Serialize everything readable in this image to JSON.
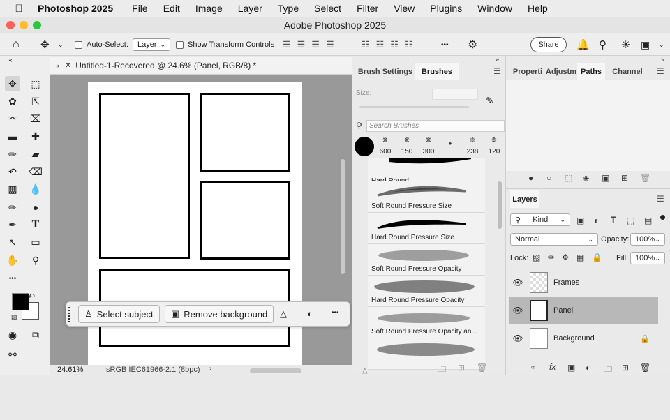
{
  "menubar": {
    "app_name": "Photoshop 2025",
    "items": [
      "File",
      "Edit",
      "Image",
      "Layer",
      "Type",
      "Select",
      "Filter",
      "View",
      "Plugins",
      "Window",
      "Help"
    ]
  },
  "window": {
    "title": "Adobe Photoshop 2025"
  },
  "options_bar": {
    "auto_select_label": "Auto-Select:",
    "auto_select_value": "Layer",
    "show_transform_label": "Show Transform Controls",
    "more_glyph": "•••",
    "share_label": "Share"
  },
  "document": {
    "tab_title": "Untitled-1-Recovered @ 24.6% (Panel, RGB/8) *",
    "zoom": "24.61%",
    "color_profile": "sRGB IEC61966-2.1 (8bpc)"
  },
  "context_bar": {
    "select_subject": "Select subject",
    "remove_background": "Remove background",
    "more_glyph": "•••"
  },
  "brush_panel": {
    "tabs": [
      "Brush Settings",
      "Brushes"
    ],
    "size_label": "Size:",
    "search_placeholder": "Search Brushes",
    "recent_sizes": [
      "600",
      "150",
      "300",
      "238",
      "120"
    ],
    "brushes": [
      "Hard Round",
      "Soft Round Pressure Size",
      "Hard Round Pressure Size",
      "Soft Round Pressure Opacity",
      "Hard Round Pressure Opacity",
      "Soft Round Pressure Opacity an..."
    ]
  },
  "properties_panel": {
    "tabs": [
      "Properti",
      "Adjustm",
      "Paths",
      "Channel"
    ]
  },
  "layers_panel": {
    "title": "Layers",
    "kind_label": "Kind",
    "blend_mode": "Normal",
    "opacity_label": "Opacity:",
    "opacity_value": "100%",
    "lock_label": "Lock:",
    "fill_label": "Fill:",
    "fill_value": "100%",
    "layers": [
      {
        "name": "Frames",
        "selected": false
      },
      {
        "name": "Panel",
        "selected": true
      },
      {
        "name": "Background",
        "selected": false
      }
    ],
    "fx_label": "fx"
  },
  "colors": {
    "selected_layer_bg": "#b8b8b8",
    "canvas_bg": "#999999",
    "foreground": "#000000",
    "background": "#ffffff"
  }
}
